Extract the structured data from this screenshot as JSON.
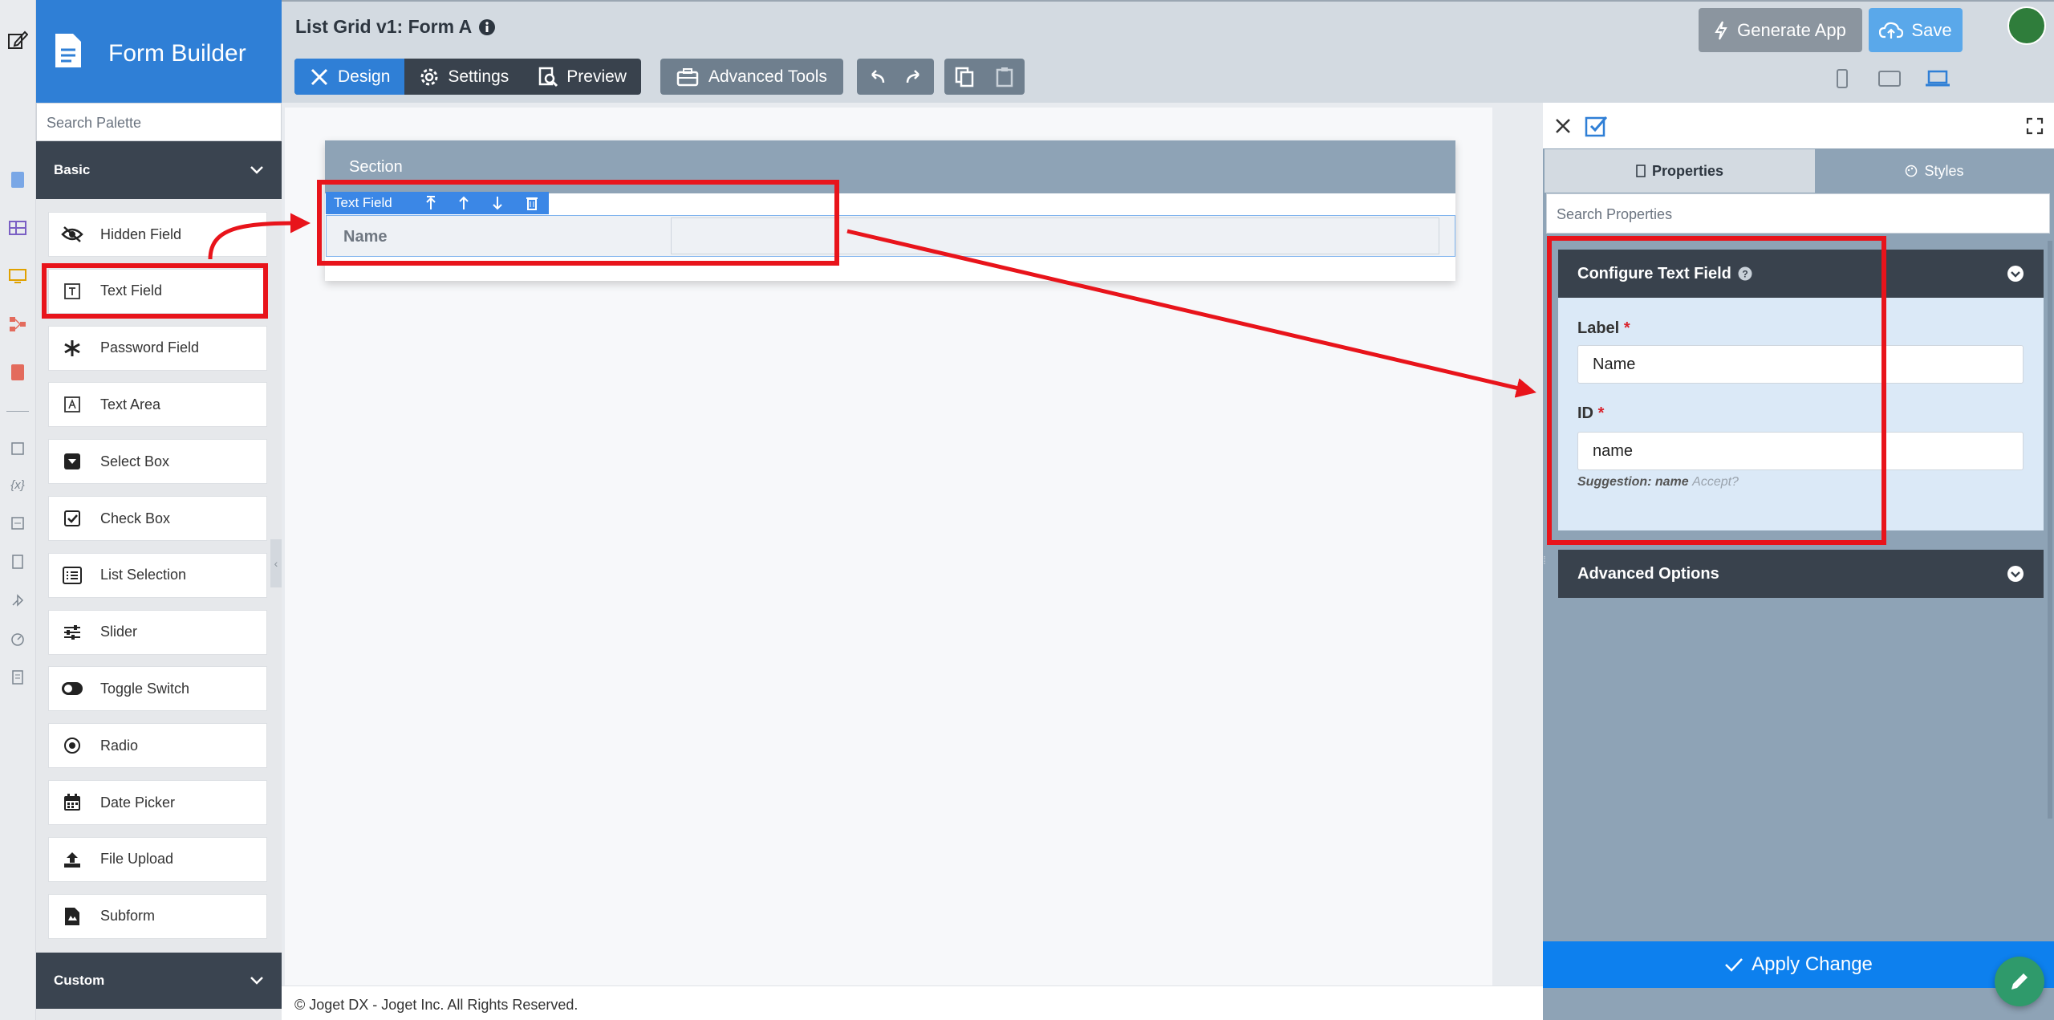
{
  "app": {
    "brand": "Form Builder",
    "form_title": "List Grid v1: Form A"
  },
  "palette": {
    "search_placeholder": "Search Palette",
    "basic_label": "Basic",
    "custom_label": "Custom",
    "items": [
      {
        "label": "Hidden Field",
        "icon": "eye-slash-icon"
      },
      {
        "label": "Text Field",
        "icon": "text-field-icon"
      },
      {
        "label": "Password Field",
        "icon": "asterisk-icon"
      },
      {
        "label": "Text Area",
        "icon": "text-area-icon"
      },
      {
        "label": "Select Box",
        "icon": "select-box-icon"
      },
      {
        "label": "Check Box",
        "icon": "checkbox-icon"
      },
      {
        "label": "List Selection",
        "icon": "list-icon"
      },
      {
        "label": "Slider",
        "icon": "slider-icon"
      },
      {
        "label": "Toggle Switch",
        "icon": "toggle-icon"
      },
      {
        "label": "Radio",
        "icon": "radio-icon"
      },
      {
        "label": "Date Picker",
        "icon": "calendar-icon"
      },
      {
        "label": "File Upload",
        "icon": "upload-icon"
      },
      {
        "label": "Subform",
        "icon": "subform-icon"
      }
    ]
  },
  "toolbar": {
    "design": "Design",
    "settings": "Settings",
    "preview": "Preview",
    "advanced_tools": "Advanced Tools",
    "generate_app": "Generate App",
    "save": "Save"
  },
  "canvas": {
    "section_title": "Section",
    "field_toolbar_label": "Text Field",
    "field_label": "Name"
  },
  "footer": {
    "text": "© Joget DX - Joget Inc. All Rights Reserved."
  },
  "properties": {
    "tab_properties": "Properties",
    "tab_styles": "Styles",
    "search_placeholder": "Search Properties",
    "configure_title": "Configure Text Field",
    "label_label": "Label",
    "label_value": "Name",
    "id_label": "ID",
    "id_value": "name",
    "suggestion_prefix": "Suggestion: name",
    "suggestion_accept": "Accept?",
    "advanced_options": "Advanced Options",
    "apply_change": "Apply Change"
  },
  "colors": {
    "accent": "#2f7fd6",
    "annotation_red": "#e8141b",
    "dark": "#39424d"
  }
}
